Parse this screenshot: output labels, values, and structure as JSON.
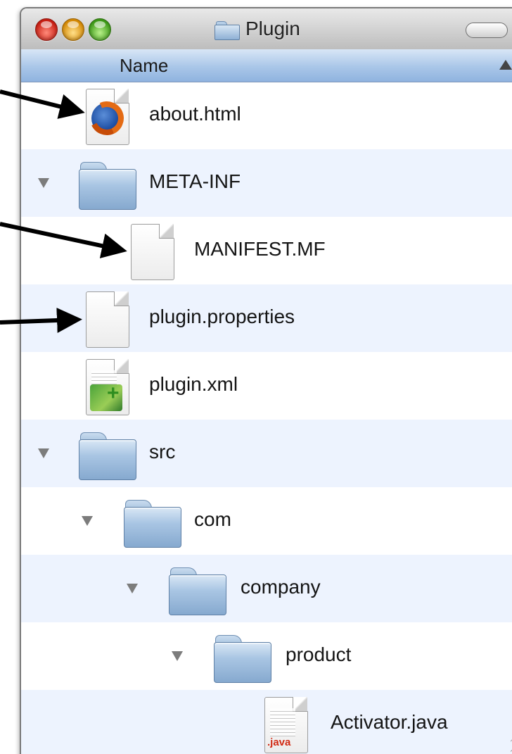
{
  "window": {
    "title": "Plugin",
    "colors": {
      "header_blue": "#a9c6e8",
      "row_alt": "#edf3fe",
      "close": "#c81d12",
      "minimize": "#d68a05",
      "zoom": "#3d9a17"
    }
  },
  "column_header": {
    "label": "Name",
    "sort": "ascending"
  },
  "rows": [
    {
      "label": "about.html",
      "icon": "firefox-html-icon",
      "level": 0,
      "expanded": null
    },
    {
      "label": "META-INF",
      "icon": "folder-icon",
      "level": 0,
      "expanded": true
    },
    {
      "label": "MANIFEST.MF",
      "icon": "document-icon",
      "level": 1,
      "expanded": null
    },
    {
      "label": "plugin.properties",
      "icon": "document-icon",
      "level": 0,
      "expanded": null
    },
    {
      "label": "plugin.xml",
      "icon": "xml-document-icon",
      "level": 0,
      "expanded": null
    },
    {
      "label": "src",
      "icon": "folder-icon",
      "level": 0,
      "expanded": true
    },
    {
      "label": "com",
      "icon": "folder-icon",
      "level": 1,
      "expanded": true
    },
    {
      "label": "company",
      "icon": "folder-icon",
      "level": 2,
      "expanded": true
    },
    {
      "label": "product",
      "icon": "folder-icon",
      "level": 3,
      "expanded": true
    },
    {
      "label": "Activator.java",
      "icon": "java-document-icon",
      "level": 4,
      "expanded": null
    }
  ],
  "java_badge": ".java",
  "annotations": {
    "arrow_count": 3,
    "arrow_color": "#000000",
    "targets": [
      "about.html",
      "MANIFEST.MF",
      "plugin.properties"
    ]
  }
}
